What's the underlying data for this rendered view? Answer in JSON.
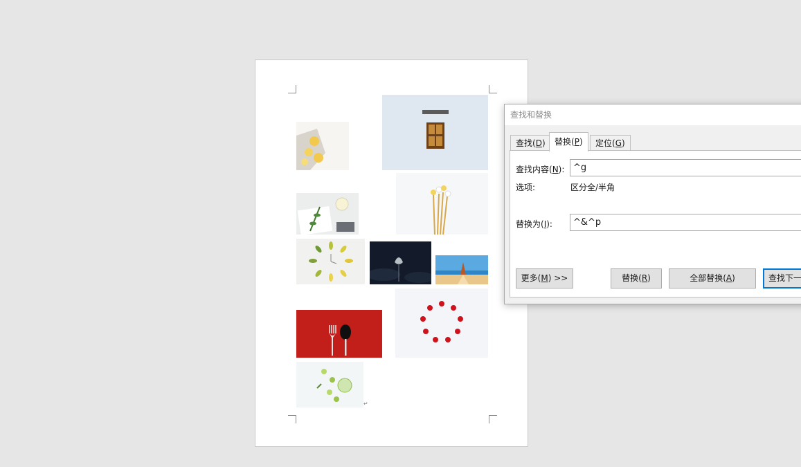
{
  "dialog": {
    "title": "查找和替换",
    "tabs": [
      {
        "label": "查找(",
        "key": "D",
        "suffix": ")",
        "active": false
      },
      {
        "label": "替换(",
        "key": "P",
        "suffix": ")",
        "active": true
      },
      {
        "label": "定位(",
        "key": "G",
        "suffix": ")",
        "active": false
      }
    ],
    "find": {
      "label": "查找内容(",
      "key": "N",
      "suffix": "):",
      "value": "^g"
    },
    "options": {
      "label": "选项:",
      "value": "区分全/半角"
    },
    "replace": {
      "label": "替换为(",
      "key": "I",
      "suffix": "):",
      "value": "^&^p"
    },
    "buttons": {
      "more": {
        "label": "更多(",
        "key": "M",
        "suffix": ") >>"
      },
      "replace": {
        "label": "替换(",
        "key": "R",
        "suffix": ")"
      },
      "replace_all": {
        "label": "全部替换(",
        "key": "A",
        "suffix": ")"
      },
      "find_next": {
        "label": "查找下一"
      }
    }
  },
  "document": {
    "pictures": [
      {
        "name": "lemon-photo",
        "colors": [
          "#f5f2ec",
          "#f2c94c"
        ]
      },
      {
        "name": "window-photo",
        "colors": [
          "#dde7ef",
          "#8a5a2b"
        ]
      },
      {
        "name": "desk-leaf-photo",
        "colors": [
          "#eceeee",
          "#4f8a3a"
        ]
      },
      {
        "name": "dried-flowers-photo",
        "colors": [
          "#f4f6f8",
          "#d9b25a"
        ]
      },
      {
        "name": "leaf-clock-photo",
        "colors": [
          "#f1f1ef",
          "#b7c23a"
        ]
      },
      {
        "name": "lotus-night-photo",
        "colors": [
          "#141c2c",
          "#9aa4ae"
        ]
      },
      {
        "name": "beach-photo",
        "colors": [
          "#5aa9e0",
          "#e9c68a"
        ]
      },
      {
        "name": "fork-spoon-photo",
        "colors": [
          "#c21f1a",
          "#111111"
        ]
      },
      {
        "name": "cherry-ring-photo",
        "colors": [
          "#f3f5f8",
          "#d0121c"
        ]
      },
      {
        "name": "lime-drink-photo",
        "colors": [
          "#f3f6f6",
          "#9bc34a"
        ]
      }
    ]
  }
}
